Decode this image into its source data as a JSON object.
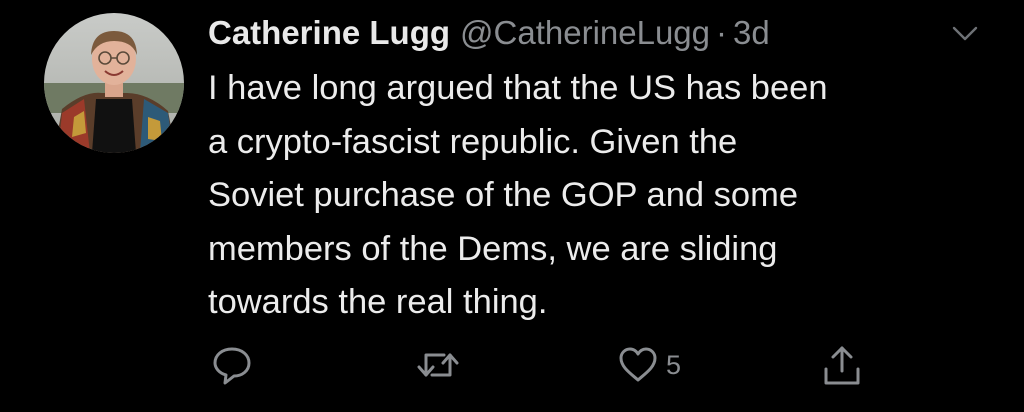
{
  "tweet": {
    "author_name": "Catherine Lugg",
    "handle": "@CatherineLugg",
    "separator": "·",
    "timestamp": "3d",
    "text_lines": [
      "I have long argued that the US has been",
      "a crypto-fascist republic. Given the",
      "Soviet purchase of the GOP and some",
      "members of the Dems, we are sliding",
      "towards the real thing."
    ]
  },
  "actions": {
    "reply_icon": "reply-icon",
    "retweet_icon": "retweet-icon",
    "like_icon": "heart-icon",
    "like_count": "5",
    "share_icon": "share-icon"
  },
  "colors": {
    "background": "#000000",
    "text": "#ececec",
    "secondary": "#8a8d91"
  }
}
